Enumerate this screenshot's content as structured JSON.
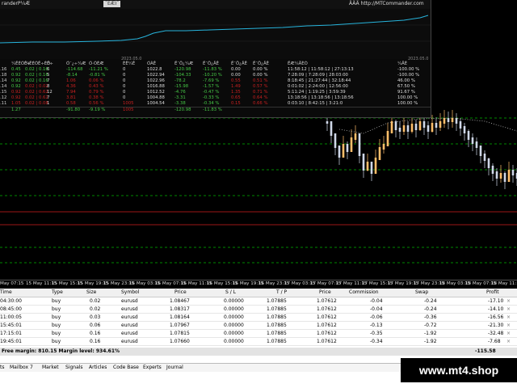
{
  "colors": {
    "bullish": "#ffbe6a",
    "bearish": "#cfd7e8",
    "level_green": "#00b400",
    "level_red": "#d21e1e",
    "equity": "#27b4dc",
    "profit_neg": "#c82020"
  },
  "overlay": {
    "title_left": "randerP¼Æ",
    "title_mid": "¯ÈÆÌ¯",
    "title_right": "ÄÄÄ http://MTCommander.com",
    "equity_date_left": "2023.05.0",
    "equity_date_right": "2023.05.0",
    "headers": [
      "¼ÊÉÓÊ÷",
      "¼ÊÉÓÊ÷ÈÕ",
      "Ê÷",
      "Ó¯¿÷¼Æ",
      "Ó·ÓÈÆ",
      "ÈÊ¼Ê",
      "ÓÀÊ",
      "Ë¯Ô¿¼Æ",
      "Ë¯Ô¿ÂÊ",
      "Ë¯Ô¿ÂÊ",
      "Ë¯Ô¿ÂÊ",
      "ËÆ¼ÄÈÓ",
      "¼ÄÈ"
    ],
    "rows": [
      {
        "id": ".16",
        "cells": [
          "0.45",
          "0.02 | 0.16",
          "6",
          "-114.68",
          "-11.21 %",
          "0",
          "1022.8",
          "-120.98",
          "-11.83 %",
          "0.00",
          "0.00 %",
          "11:58:12 | 11:58:12 | 27:13:13",
          "-100.00 %"
        ]
      },
      {
        "id": ".18",
        "cells": [
          "0.92",
          "0.02 | 0.16",
          "5",
          "-8.14",
          "-0.81 %",
          "0",
          "1022.94",
          "-104.33",
          "-10.20 %",
          "0.00",
          "0.00 %",
          "7:28:09 | 7:28:09 | 28:03:00",
          "-100.00 %"
        ]
      },
      {
        "id": ".14",
        "cells": [
          "0.92",
          "0.02 | 0.16",
          "7",
          "1.06",
          "0.06 %",
          "0",
          "1022.96",
          "-78.2",
          "-7.69 %",
          "0.55",
          "0.51 %",
          "8:18:45 | 21:27:44 | 32:18:44",
          "46.00 %"
        ]
      },
      {
        "id": ".14",
        "cells": [
          "0.92",
          "0.02 | 0.02",
          "8",
          "4.36",
          "0.43 %",
          "0",
          "1016.88",
          "-15.98",
          "-1.57 %",
          "1.49",
          "0.57 %",
          "0:01:02 | 2:24:00 | 12:56:00",
          "67.50 %"
        ]
      },
      {
        "id": ".15",
        "cells": [
          "0.92",
          "0.02 | 0.62",
          "12",
          "7.94",
          "0.79 %",
          "0",
          "1012.52",
          "-4.76",
          "-0.47 %",
          "1.35",
          "0.71 %",
          "5:11:24 | 1:19:25 | 3:59:39",
          "91.67 %"
        ]
      },
      {
        "id": ".12",
        "cells": [
          "0.92",
          "0.02 | 0.62",
          "7",
          "3.81",
          "0.38 %",
          "0",
          "1004.88",
          "-3.31",
          "-0.33 %",
          "0.65",
          "0.64 %",
          "13:18:56 | 13:18:56 | 13:18:56",
          "100.00 %"
        ]
      },
      {
        "id": ".11",
        "cells": [
          "1.05",
          "0.02 | 0.08",
          "1",
          "0.58",
          "0.56 %",
          "1005",
          "1004.54",
          "-3.38",
          "-0.34 %",
          "0.15",
          "0.66 %",
          "0:03:10 | 8:42:15 | 3:21:0",
          "100.00 %"
        ]
      }
    ],
    "totals": [
      "1.27",
      "",
      "",
      "-91.80",
      "-9.19 %",
      "1005",
      "",
      "-120.98",
      "-11.83 %",
      "",
      "",
      "",
      ""
    ]
  },
  "time_axis": [
    "May 07:15",
    "15 May 11:15",
    "15 May 15:15",
    "15 May 19:15",
    "15 May 23:15",
    "16 May 03:15",
    "16 May 07:15",
    "16 May 11:15",
    "16 May 15:15",
    "16 May 19:15",
    "16 May 23:15",
    "17 May 03:15",
    "17 May 07:15",
    "17 May 11:15",
    "17 May 15:15",
    "17 May 19:15",
    "17 May 23:15",
    "18 May 03:15",
    "18 May 07:15",
    "18 May 11:15"
  ],
  "terminal": {
    "columns": [
      "Time",
      "Type",
      "Size",
      "Symbol",
      "Price",
      "S / L",
      "T / P",
      "Price",
      "Commission",
      "Swap",
      "Profit"
    ],
    "rows": [
      {
        "time": "04:30:00",
        "type": "buy",
        "size": "0.02",
        "symbol": "eurusd",
        "price": "1.08467",
        "sl": "0.00000",
        "tp": "1.07885",
        "cur": "1.07612",
        "commission": "-0.04",
        "swap": "-0.24",
        "profit": "-17.10"
      },
      {
        "time": "08:45:00",
        "type": "buy",
        "size": "0.02",
        "symbol": "eurusd",
        "price": "1.08317",
        "sl": "0.00000",
        "tp": "1.07885",
        "cur": "1.07612",
        "commission": "-0.04",
        "swap": "-0.24",
        "profit": "-14.10"
      },
      {
        "time": "11:00:05",
        "type": "buy",
        "size": "0.03",
        "symbol": "eurusd",
        "price": "1.08164",
        "sl": "0.00000",
        "tp": "1.07885",
        "cur": "1.07612",
        "commission": "-0.06",
        "swap": "-0.36",
        "profit": "-16.56"
      },
      {
        "time": "15:45:01",
        "type": "buy",
        "size": "0.06",
        "symbol": "eurusd",
        "price": "1.07967",
        "sl": "0.00000",
        "tp": "1.07885",
        "cur": "1.07612",
        "commission": "-0.13",
        "swap": "-0.72",
        "profit": "-21.30"
      },
      {
        "time": "17:15:01",
        "type": "buy",
        "size": "0.16",
        "symbol": "eurusd",
        "price": "1.07815",
        "sl": "0.00000",
        "tp": "1.07885",
        "cur": "1.07612",
        "commission": "-0.35",
        "swap": "-1.92",
        "profit": "-32.48"
      },
      {
        "time": "19:45:01",
        "type": "buy",
        "size": "0.16",
        "symbol": "eurusd",
        "price": "1.07660",
        "sl": "0.00000",
        "tp": "1.07885",
        "cur": "1.07612",
        "commission": "-0.34",
        "swap": "-1.92",
        "profit": "-7.68"
      }
    ],
    "summary": "Free margin: 810.15   Margin level: 934.61%",
    "total_profit": "-115.58",
    "tabs": [
      "ts",
      "Mailbox",
      "Market",
      "Signals",
      "Articles",
      "Code Base",
      "Experts",
      "Journal"
    ],
    "mailbox_badge": "7"
  },
  "watermark": "www.mt4.shop"
}
